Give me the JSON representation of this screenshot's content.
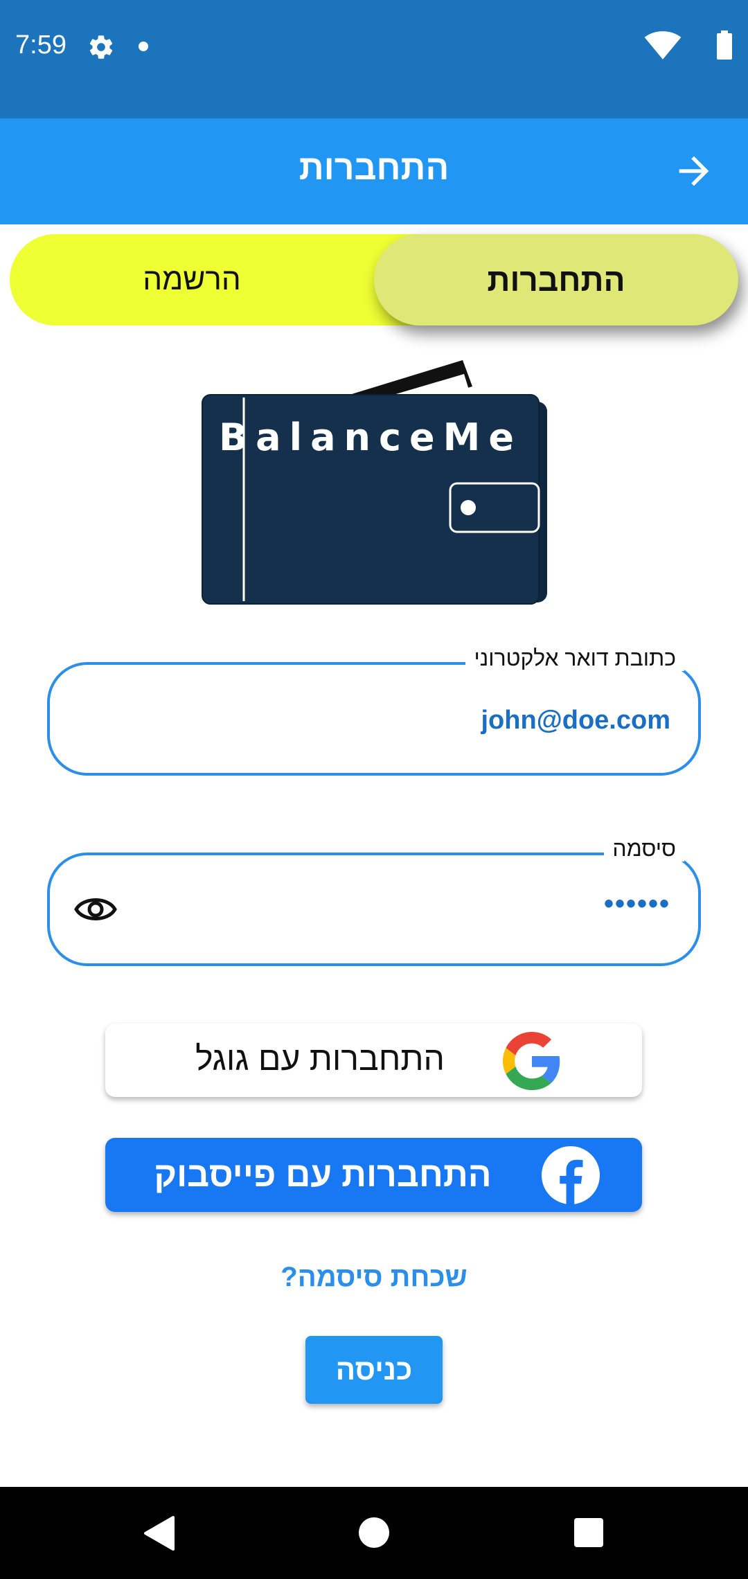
{
  "status_bar": {
    "time": "7:59",
    "icons": [
      "settings-icon",
      "notification-dot",
      "wifi-icon",
      "battery-icon"
    ]
  },
  "app_bar": {
    "title": "התחברות",
    "back_icon": "arrow-right-icon"
  },
  "toggle": {
    "register_label": "הרשמה",
    "login_label": "התחברות",
    "selected": "login"
  },
  "logo": {
    "text": "BalanceMe"
  },
  "email_field": {
    "label": "כתובת דואר אלקטרוני",
    "value": "john@doe.com"
  },
  "password_field": {
    "label": "סיסמה",
    "value": "••••••",
    "visibility_icon": "eye-icon"
  },
  "google_button": {
    "label": "התחברות עם גוגל",
    "icon": "google-icon"
  },
  "facebook_button": {
    "label": "התחברות עם פייסבוק",
    "icon": "facebook-icon"
  },
  "forgot_password": {
    "label": "שכחת סיסמה?"
  },
  "enter_button": {
    "label": "כניסה"
  },
  "nav_bar": {
    "icons": [
      "back-triangle-icon",
      "home-circle-icon",
      "recents-square-icon"
    ]
  },
  "colors": {
    "status_bar": "#1c74bd",
    "app_bar": "#2196f3",
    "toggle_background": "#eeff33",
    "toggle_selected": "#dfe877",
    "field_border": "#2b8ee8",
    "facebook": "#1877f2",
    "logo_wallet": "#15304c"
  }
}
